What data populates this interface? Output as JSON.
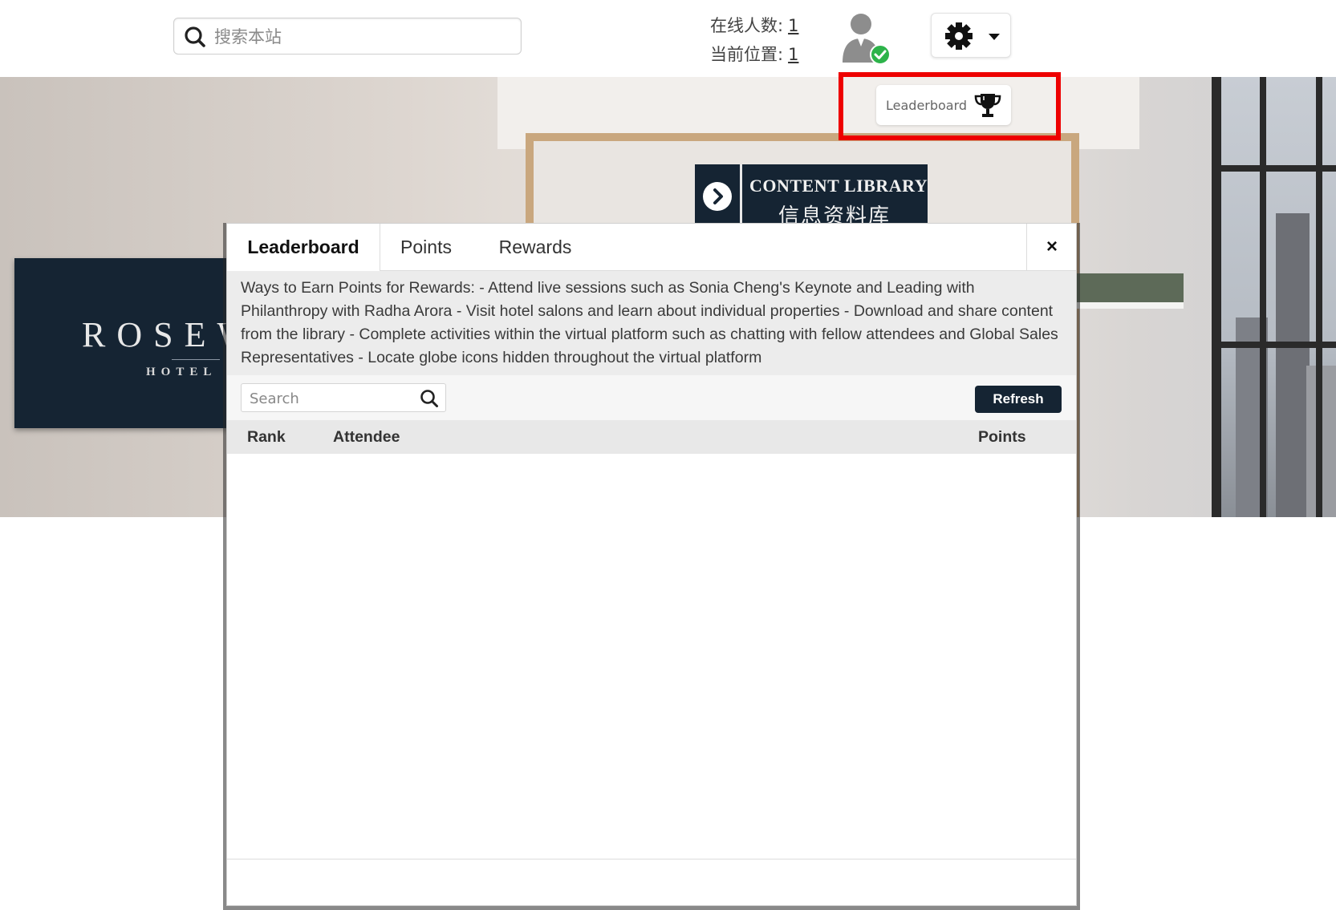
{
  "header": {
    "search_placeholder": "搜索本站",
    "online_label": "在线人数:",
    "online_count": "1",
    "location_label": "当前位置:",
    "location_count": "1"
  },
  "scene": {
    "brand_name": "ROSEW",
    "brand_sub": "HOTEL",
    "content_library_en": "CONTENT LIBRARY",
    "content_library_zh": "信息资料库"
  },
  "leaderboard_button": {
    "label": "Leaderboard"
  },
  "modal": {
    "tabs": [
      {
        "label": "Leaderboard",
        "active": true
      },
      {
        "label": "Points",
        "active": false
      },
      {
        "label": "Rewards",
        "active": false
      }
    ],
    "close_label": "×",
    "info_text": "Ways to Earn Points for Rewards: - Attend live sessions such as Sonia Cheng's Keynote and Leading with Philanthropy with Radha Arora - Visit hotel salons and learn about individual properties - Download and share content from the library - Complete activities within the virtual platform such as chatting with fellow attendees and Global Sales Representatives - Locate globe icons hidden throughout the virtual platform",
    "search_placeholder": "Search",
    "refresh_label": "Refresh",
    "columns": {
      "rank": "Rank",
      "attendee": "Attendee",
      "points": "Points"
    },
    "rows": []
  },
  "colors": {
    "brand_navy": "#152433",
    "highlight_red": "#ee0000",
    "status_green": "#2db34a"
  }
}
